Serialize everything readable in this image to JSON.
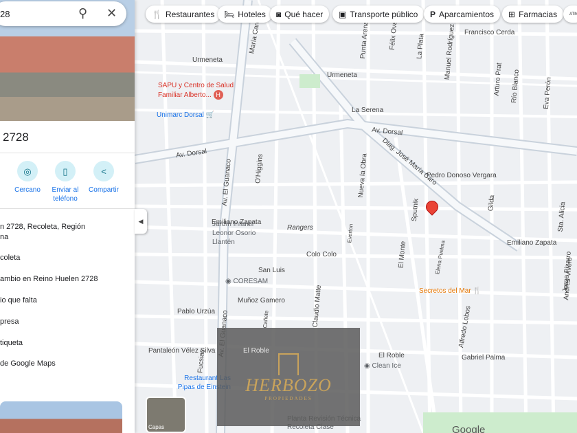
{
  "search": {
    "value": "28"
  },
  "place": {
    "title": "2728"
  },
  "actions": [
    {
      "label": "Cercano",
      "icon": "nearby-icon"
    },
    {
      "label": "Enviar al teléfono",
      "icon": "send-to-phone-icon"
    },
    {
      "label": "Compartir",
      "icon": "share-icon"
    }
  ],
  "info_rows": [
    "n 2728, Recoleta, Región",
    "na",
    "coleta",
    "ambio en Reino Huelen 2728",
    "io que falta",
    "presa",
    "tiqueta",
    "de Google Maps"
  ],
  "chips": [
    "Restaurantes",
    "Hoteles",
    "Qué hacer",
    "Transporte público",
    "Aparcamientos",
    "Farmacias"
  ],
  "streets": [
    "Urmeneta",
    "Urmeneta",
    "Francisco Cerda",
    "La Serena",
    "Av. Dorsal",
    "Av. Dorsal",
    "Pedro Donoso Vergara",
    "Emiliano Zapata",
    "Emiliano Zapata",
    "Rangers",
    "Colo Colo",
    "San Luis",
    "Muñoz Gamero",
    "Pablo Urzúa",
    "Pantaleón Vélez Silva",
    "El Roble",
    "El Roble",
    "Gabriel Palma",
    "Av. El Guanaco",
    "Av. El Guanaco",
    "O'Higgins",
    "Nueva la Obra",
    "Diag. José María Caro",
    "Sputnik",
    "Gilda",
    "El Monte",
    "Claudio Matte",
    "Alfredo Lobos",
    "Arturo Prat",
    "Río Blanco",
    "Eva Perón",
    "Sta. Alicia",
    "Jorge Pizarro",
    "Andrés Vivero",
    "Fucsias",
    "Everton",
    "Cañete",
    "Elena Puelma",
    "Manuel Rodríguez",
    "La Plata",
    "Félix Oval",
    "Punta Arenas",
    "María Caro"
  ],
  "pois": {
    "sapu": "SAPU y Centro de Salud Familiar Alberto...",
    "unimarc": "Unimarc Dorsal",
    "jardin": "Jardín Infantil Leonor Osorio Llantén",
    "coresam": "CORESAM",
    "secretos": "Secretos del Mar",
    "clean": "Clean Ice",
    "restaurant": "Restaurant Las Pipas de Einstein",
    "planta": "Planta Revisión Técnica Recoleta Clase"
  },
  "watermark": {
    "brand": "HERBOZO",
    "sub": "PROPIEDADES"
  },
  "layers_label": "Capas",
  "google_logo": "Google",
  "colors": {
    "pin": "#ea4335",
    "accent": "#1a73e8"
  }
}
